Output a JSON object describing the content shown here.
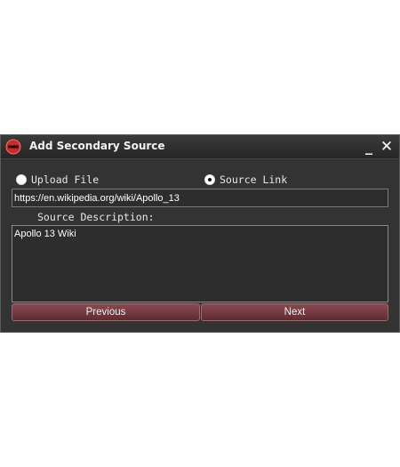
{
  "window": {
    "title": "Add Secondary Source",
    "minimize_label": "_",
    "close_label": "✕",
    "icon": "app-logo-icon"
  },
  "source_type": {
    "options": [
      {
        "label": "Upload File",
        "selected": false
      },
      {
        "label": "Source Link",
        "selected": true
      }
    ]
  },
  "url_field": {
    "value": "https://en.wikipedia.org/wiki/Apollo_13"
  },
  "description": {
    "label": "Source Description:",
    "value": "Apollo 13 Wiki"
  },
  "buttons": {
    "previous": "Previous",
    "next": "Next"
  },
  "colors": {
    "dialog_bg": "#333333",
    "button_accent": "#7a3a42",
    "logo_red": "#d22b2b"
  }
}
